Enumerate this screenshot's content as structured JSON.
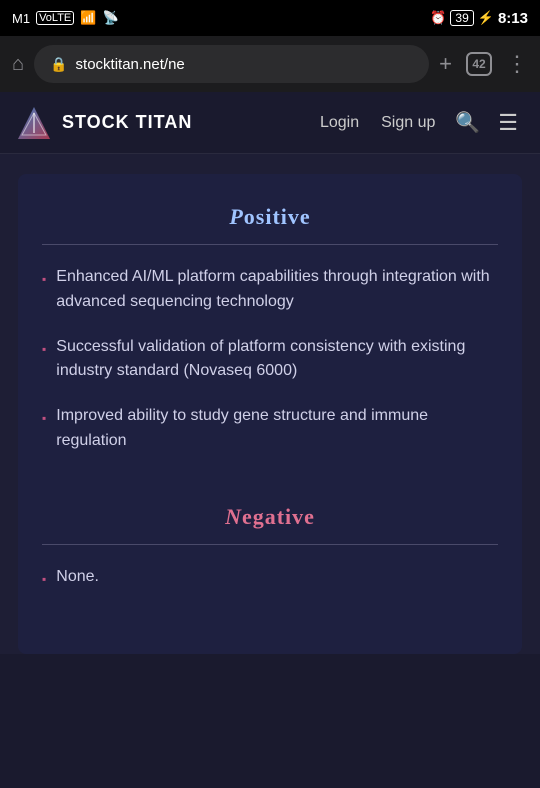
{
  "status_bar": {
    "carrier": "M1",
    "carrier_type": "VoLTE",
    "signal_bars": "▂▄▆",
    "wifi": "WiFi",
    "alarm_icon": "⏰",
    "battery_level": "39",
    "charging": true,
    "time": "8:13"
  },
  "browser": {
    "home_icon": "⌂",
    "url": "stocktitan.net/ne",
    "add_tab_icon": "+",
    "tabs_count": "42",
    "menu_icon": "⋮"
  },
  "site_header": {
    "title": "STOCK TITAN",
    "login_label": "Login",
    "signup_label": "Sign up"
  },
  "content": {
    "positive": {
      "title": "Positive",
      "bullets": [
        "Enhanced AI/ML platform capabilities through integration with advanced sequencing technology",
        "Successful validation of platform consistency with existing industry standard (Novaseq 6000)",
        "Improved ability to study gene structure and immune regulation"
      ]
    },
    "negative": {
      "title": "Negative",
      "bullets": [
        "None."
      ]
    }
  }
}
